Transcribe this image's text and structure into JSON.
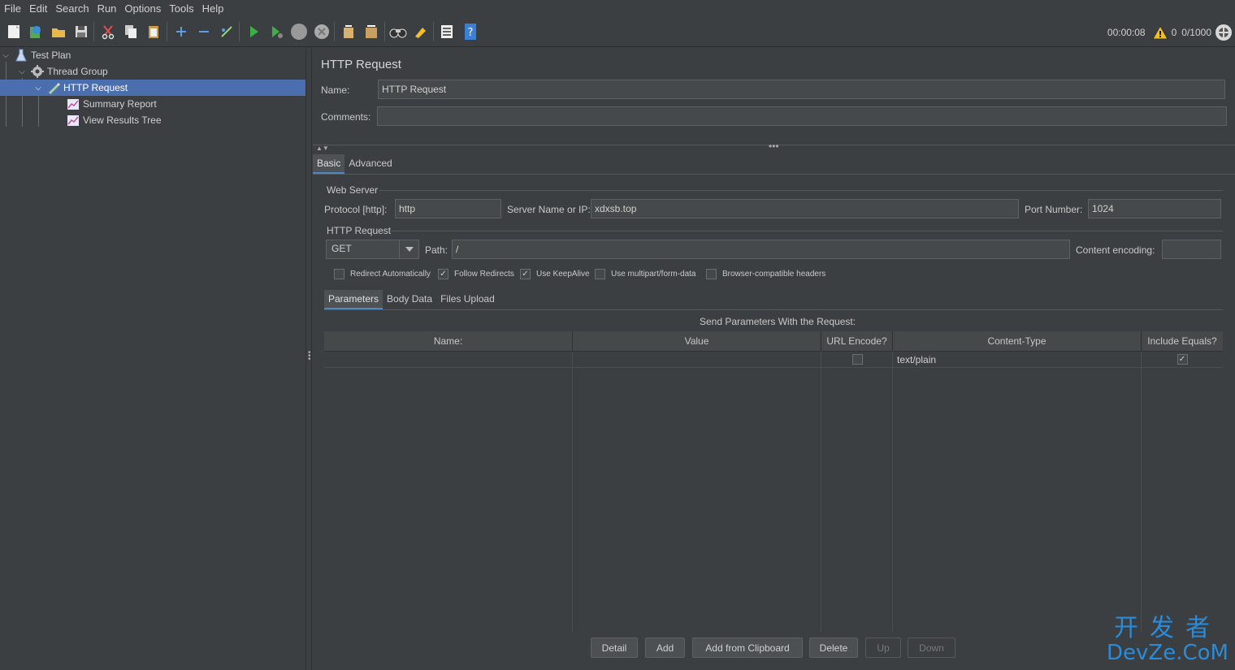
{
  "menu": {
    "file": "File",
    "edit": "Edit",
    "search": "Search",
    "run": "Run",
    "options": "Options",
    "tools": "Tools",
    "help": "Help"
  },
  "status": {
    "timer": "00:00:08",
    "warnings": "0",
    "threads": "0/1000"
  },
  "tree": {
    "test_plan": "Test Plan",
    "thread_group": "Thread Group",
    "http_request": "HTTP Request",
    "summary_report": "Summary Report",
    "view_results_tree": "View Results Tree"
  },
  "panel": {
    "title": "HTTP Request",
    "name_label": "Name:",
    "name_value": "HTTP Request",
    "comments_label": "Comments:",
    "comments_value": "",
    "tabs": [
      "Basic",
      "Advanced"
    ],
    "web_server": {
      "section": "Web Server",
      "protocol_label": "Protocol [http]:",
      "protocol_value": "http",
      "server_label": "Server Name or IP:",
      "server_value": "xdxsb.top",
      "port_label": "Port Number:",
      "port_value": "1024"
    },
    "http_request": {
      "section": "HTTP Request",
      "method": "GET",
      "path_label": "Path:",
      "path_value": "/",
      "encoding_label": "Content encoding:",
      "encoding_value": ""
    },
    "options": [
      {
        "label": "Redirect Automatically",
        "checked": false
      },
      {
        "label": "Follow Redirects",
        "checked": true
      },
      {
        "label": "Use KeepAlive",
        "checked": true
      },
      {
        "label": "Use multipart/form-data",
        "checked": false
      },
      {
        "label": "Browser-compatible headers",
        "checked": false
      }
    ],
    "sub_tabs": [
      "Parameters",
      "Body Data",
      "Files Upload"
    ],
    "table_caption": "Send Parameters With the Request:",
    "columns": [
      "Name:",
      "Value",
      "URL Encode?",
      "Content-Type",
      "Include Equals?"
    ],
    "rows": [
      {
        "name": "",
        "value": "",
        "url_encode": false,
        "content_type": "text/plain",
        "include_equals": true
      }
    ],
    "buttons": [
      "Detail",
      "Add",
      "Add from Clipboard",
      "Delete",
      "Up",
      "Down"
    ]
  },
  "watermark": {
    "top": "开发者",
    "bottom": "DevZe.CoM"
  },
  "colors": {
    "accent": "#4b6eaf",
    "background": "#3c3f41",
    "field": "#45494a"
  }
}
